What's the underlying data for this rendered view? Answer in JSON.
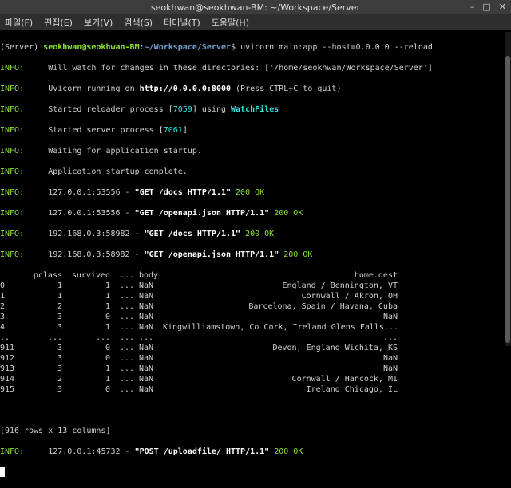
{
  "window": {
    "title": "seokhwan@seokhwan-BM: ~/Workspace/Server",
    "btn_min": "–",
    "btn_max": "□",
    "btn_close": "✕"
  },
  "menu": [
    "파일(F)",
    "편집(E)",
    "보기(V)",
    "검색(S)",
    "터미널(T)",
    "도움말(H)"
  ],
  "prompt": {
    "env": "(Server) ",
    "user": "seokhwan@seokhwan-BM",
    "colon": ":",
    "path": "~/Workspace/Server",
    "dollar": "$ ",
    "command": "uvicorn main:app --host=0.0.0.0 --reload"
  },
  "logs": {
    "l1": "Will watch for changes in these directories: ['/home/seokhwan/Workspace/Server']",
    "l2a": "Uvicorn running on ",
    "l2url": "http://0.0.0.0:8000",
    "l2b": " (Press CTRL+C to quit)",
    "l3a": "Started reloader process [",
    "l3pid": "7059",
    "l3b": "] using ",
    "l3c": "WatchFiles",
    "l4a": "Started server process [",
    "l4pid": "7061",
    "l4b": "]",
    "l5": "Waiting for application startup.",
    "l6": "Application startup complete.",
    "req1a": "127.0.0.1:53556 - ",
    "req1b": "\"GET /docs HTTP/1.1\"",
    "req1c": " 200 OK",
    "req2a": "127.0.0.1:53556 - ",
    "req2b": "\"GET /openapi.json HTTP/1.1\"",
    "req2c": " 200 OK",
    "req3a": "192.168.0.3:58982 - ",
    "req3b": "\"GET /docs HTTP/1.1\"",
    "req3c": " 200 OK",
    "req4a": "192.168.0.3:58982 - ",
    "req4b": "\"GET /openapi.json HTTP/1.1\"",
    "req4c": " 200 OK",
    "req5a": "127.0.0.1:45732 - ",
    "req5b": "\"POST /uploadfile/ HTTP/1.1\"",
    "req5c": " 200 OK"
  },
  "info_label": "INFO:",
  "table": {
    "header": [
      "",
      "pclass",
      "survived",
      "...",
      "body",
      "home.dest"
    ],
    "rows": [
      [
        "0",
        "1",
        "1",
        "...",
        "NaN",
        "England / Bennington, VT"
      ],
      [
        "1",
        "1",
        "1",
        "...",
        "NaN",
        "Cornwall / Akron, OH"
      ],
      [
        "2",
        "2",
        "1",
        "...",
        "NaN",
        "Barcelona, Spain / Havana, Cuba"
      ],
      [
        "3",
        "3",
        "0",
        "...",
        "NaN",
        "NaN"
      ],
      [
        "4",
        "3",
        "1",
        "...",
        "NaN",
        "Kingwilliamstown, Co Cork, Ireland Glens Falls..."
      ],
      [
        "..",
        "...",
        "...",
        "...",
        "...",
        "..."
      ],
      [
        "911",
        "3",
        "0",
        "...",
        "NaN",
        "Devon, England Wichita, KS"
      ],
      [
        "912",
        "3",
        "0",
        "...",
        "NaN",
        "NaN"
      ],
      [
        "913",
        "3",
        "1",
        "...",
        "NaN",
        "NaN"
      ],
      [
        "914",
        "2",
        "1",
        "...",
        "NaN",
        "Cornwall / Hancock, MI"
      ],
      [
        "915",
        "3",
        "0",
        "...",
        "NaN",
        "Ireland Chicago, IL"
      ]
    ],
    "summary": "[916 rows x 13 columns]"
  }
}
